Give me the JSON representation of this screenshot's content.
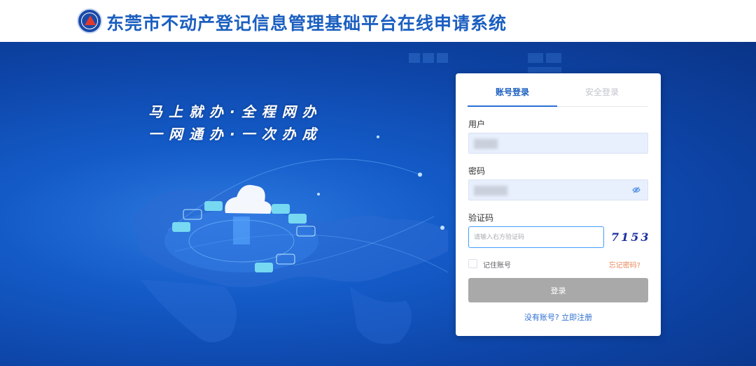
{
  "header": {
    "title": "东莞市不动产登记信息管理基础平台在线申请系统",
    "logo_icon": "emblem-icon"
  },
  "hero": {
    "slogan_line1": "马上就办·全程网办",
    "slogan_line2": "一网通办·一次办成"
  },
  "login": {
    "tabs": [
      {
        "label": "账号登录",
        "active": true
      },
      {
        "label": "安全登录",
        "active": false
      }
    ],
    "username": {
      "label": "用户",
      "value": ""
    },
    "password": {
      "label": "密码",
      "value": "",
      "toggle_icon": "eye-icon"
    },
    "captcha": {
      "label": "验证码",
      "placeholder": "请输入右方验证码",
      "image_text": "7153"
    },
    "remember_label": "记住账号",
    "forgot_label": "忘记密码?",
    "submit_label": "登录",
    "register_label": "没有账号? 立即注册"
  },
  "colors": {
    "brand_blue": "#1b5fc0",
    "hero_blue": "#0d44a6",
    "button_gray": "#a9a9a9",
    "forgot_orange": "#e6875a"
  }
}
